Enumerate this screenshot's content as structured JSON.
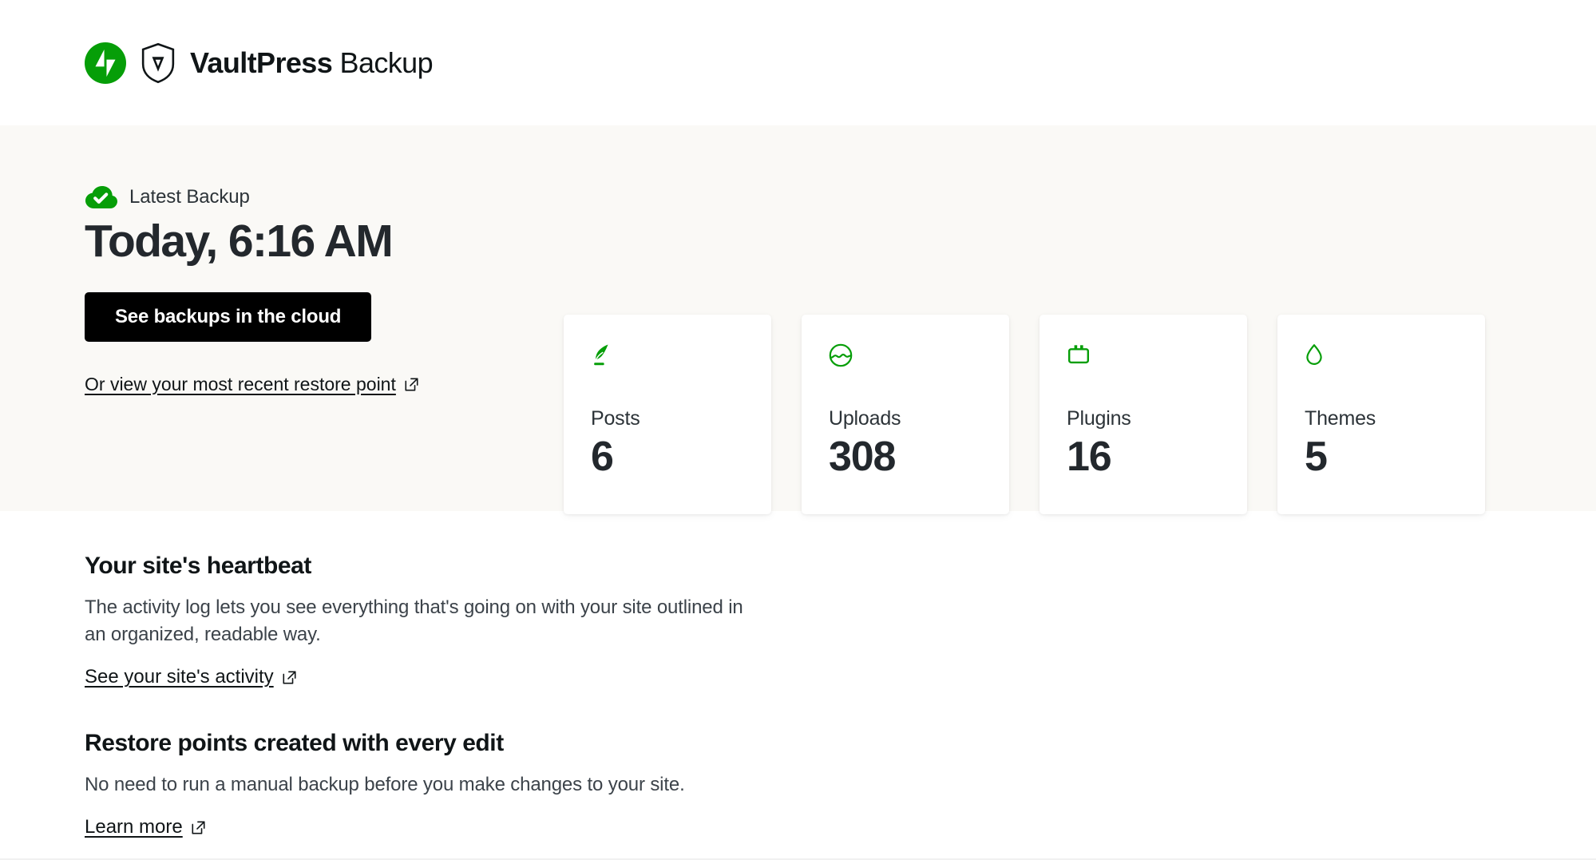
{
  "brand": {
    "name_bold": "VaultPress",
    "name_light": " Backup",
    "jetpack_icon": "jetpack-logo-icon",
    "shield_icon": "vaultpress-shield-icon",
    "green": "#069e08"
  },
  "hero": {
    "status_icon": "cloud-check-icon",
    "status_label": "Latest Backup",
    "backup_time": "Today, 6:16 AM",
    "primary_button": "See backups in the cloud",
    "restore_link": "Or view your most recent restore point",
    "external_icon": "external-link-icon",
    "background": "#faf9f6"
  },
  "stats": [
    {
      "icon": "quill-icon",
      "label": "Posts",
      "value": "6"
    },
    {
      "icon": "image-circle-icon",
      "label": "Uploads",
      "value": "308"
    },
    {
      "icon": "plugin-icon",
      "label": "Plugins",
      "value": "16"
    },
    {
      "icon": "droplet-icon",
      "label": "Themes",
      "value": "5"
    }
  ],
  "sections": [
    {
      "title": "Your site's heartbeat",
      "body": "The activity log lets you see everything that's going on with your site outlined in an organized, readable way.",
      "link": "See your site's activity",
      "link_icon": "external-link-icon"
    },
    {
      "title": "Restore points created with every edit",
      "body": "No need to run a manual backup before you make changes to your site.",
      "link": "Learn more",
      "link_icon": "external-link-icon"
    }
  ]
}
